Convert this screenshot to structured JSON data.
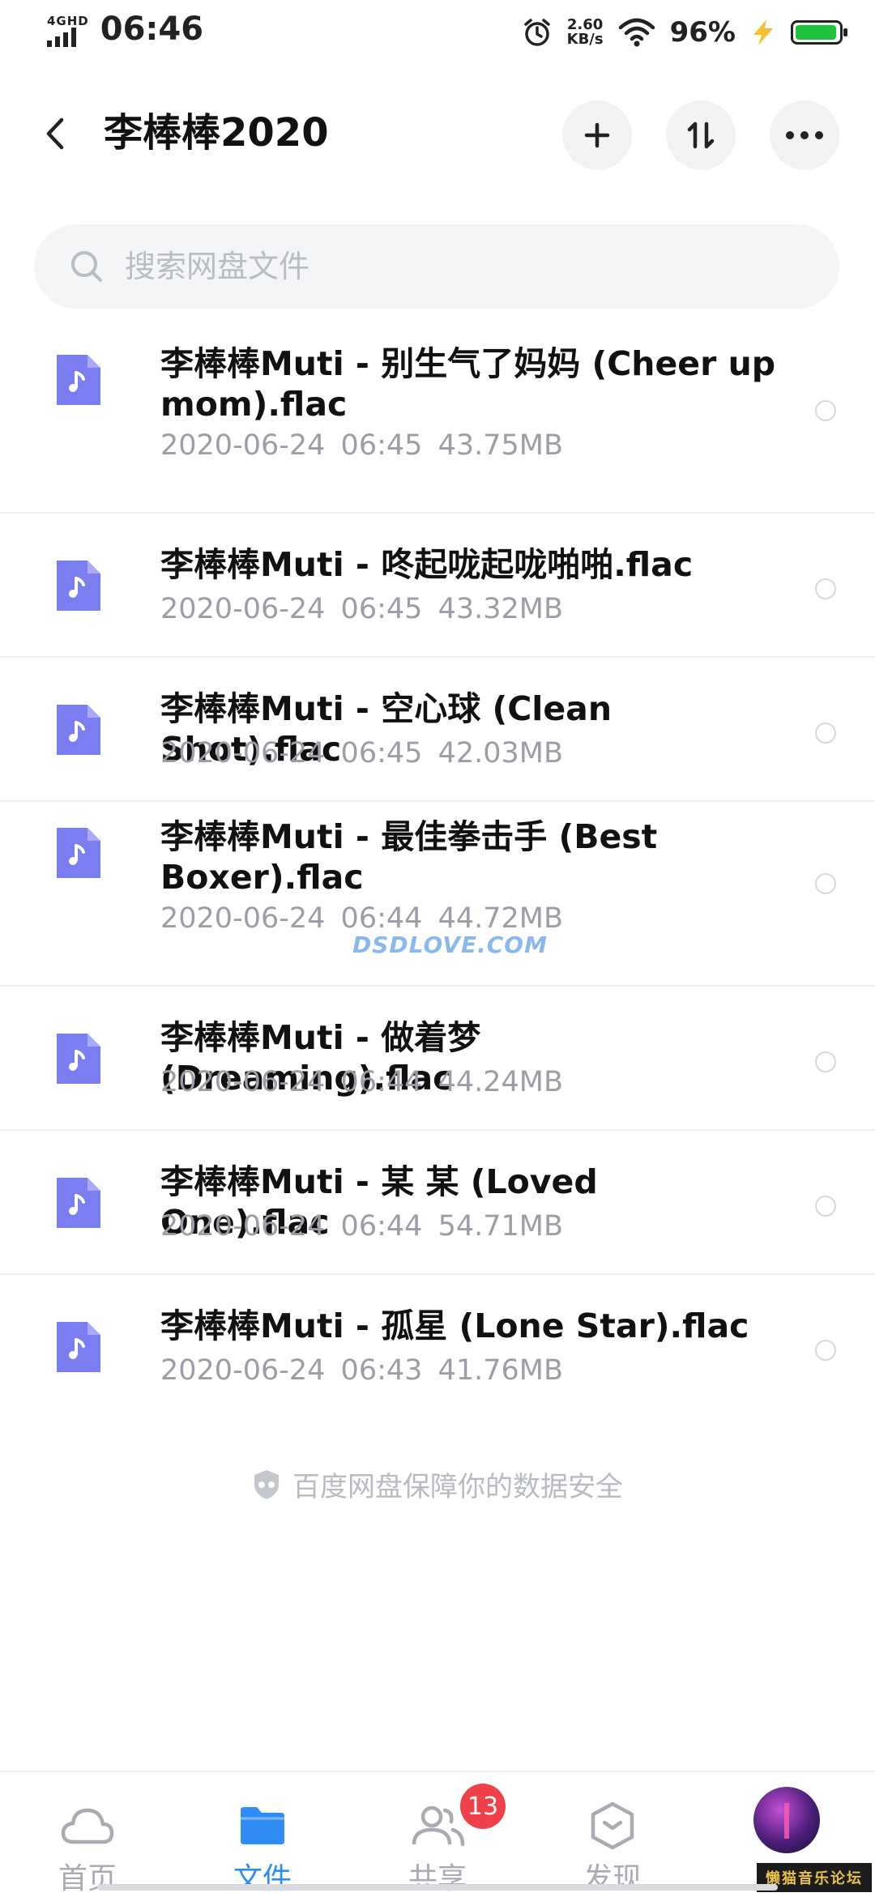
{
  "status_bar": {
    "network_label": "4GHD",
    "time": "06:46",
    "speed_value": "2.60",
    "speed_unit": "KB/s",
    "battery_percent": "96%",
    "battery_level": 0.96,
    "icons": [
      "signal-icon",
      "alarm-icon",
      "wifi-icon",
      "charging-icon",
      "battery-icon"
    ]
  },
  "header": {
    "title": "李棒棒2020",
    "back_icon": "chevron-left-icon",
    "buttons": [
      "add-icon",
      "sort-icon",
      "more-icon"
    ]
  },
  "search": {
    "placeholder": "搜索网盘文件",
    "value": ""
  },
  "files": [
    {
      "name": "李棒棒Muti - 别生气了妈妈 (Cheer up mom).flac",
      "date": "2020-06-24",
      "time": "06:45",
      "size": "43.75MB",
      "icon": "music-file-icon"
    },
    {
      "name": "李棒棒Muti - 咚起咙起咙啪啪.flac",
      "date": "2020-06-24",
      "time": "06:45",
      "size": "43.32MB",
      "icon": "music-file-icon"
    },
    {
      "name": "李棒棒Muti - 空心球 (Clean Shot).flac",
      "date": "2020-06-24",
      "time": "06:45",
      "size": "42.03MB",
      "icon": "music-file-icon"
    },
    {
      "name": "李棒棒Muti - 最佳拳击手 (Best Boxer).flac",
      "date": "2020-06-24",
      "time": "06:44",
      "size": "44.72MB",
      "icon": "music-file-icon"
    },
    {
      "name": "李棒棒Muti - 做着梦 (Dreaming).flac",
      "date": "2020-06-24",
      "time": "06:44",
      "size": "44.24MB",
      "icon": "music-file-icon"
    },
    {
      "name": "李棒棒Muti - 某 某 (Loved One).flac",
      "date": "2020-06-24",
      "time": "06:44",
      "size": "54.71MB",
      "icon": "music-file-icon"
    },
    {
      "name": "李棒棒Muti - 孤星 (Lone Star).flac",
      "date": "2020-06-24",
      "time": "06:43",
      "size": "41.76MB",
      "icon": "music-file-icon"
    }
  ],
  "watermark": "DSDLOVE.COM",
  "footer_note": "百度网盘保障你的数据安全",
  "tabs": [
    {
      "label": "首页",
      "icon": "cloud-icon",
      "active": false
    },
    {
      "label": "文件",
      "icon": "folder-icon",
      "active": true
    },
    {
      "label": "共享",
      "icon": "people-icon",
      "active": false,
      "badge": "13"
    },
    {
      "label": "发现",
      "icon": "discover-icon",
      "active": false
    }
  ],
  "forum_watermark": "懒猫音乐论坛",
  "colors": {
    "accent": "#2f8cf5",
    "file_icon": "#7b7ef0",
    "badge": "#f0404a",
    "battery": "#1fc43a",
    "charging": "#f2c230"
  }
}
